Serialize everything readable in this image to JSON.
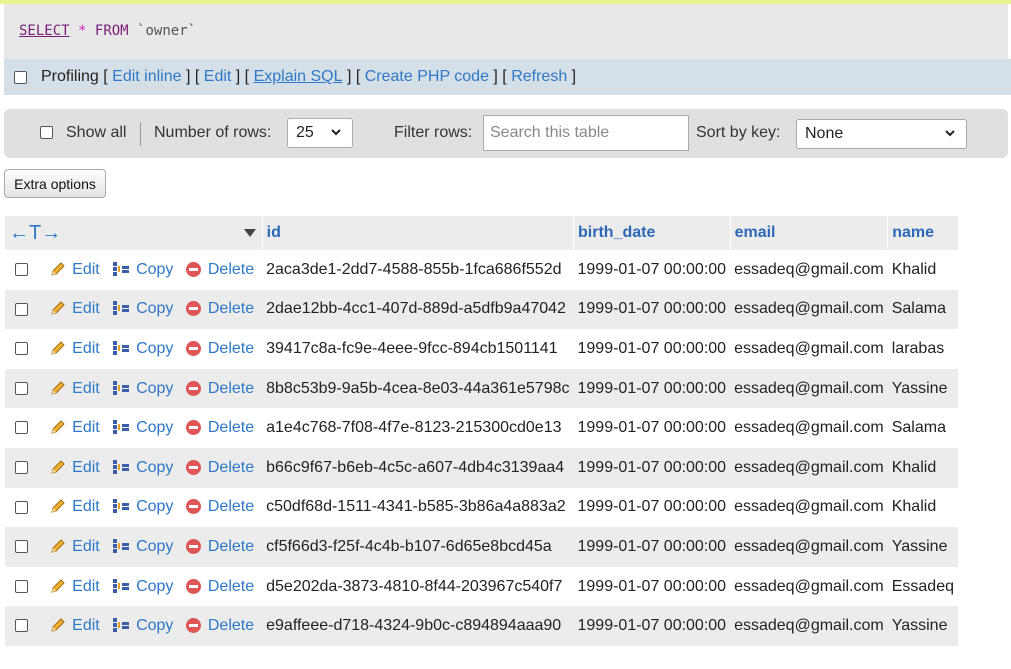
{
  "sql": {
    "select": "SELECT",
    "star": "*",
    "from": "FROM",
    "table": "`owner`"
  },
  "profiling": {
    "label": "Profiling",
    "links": [
      "Edit inline",
      "Edit",
      "Explain SQL",
      "Create PHP code",
      "Refresh"
    ]
  },
  "nav": {
    "show_all": "Show all",
    "rows_label": "Number of rows:",
    "rows_value": "25",
    "filter_label": "Filter rows:",
    "search_placeholder": "Search this table",
    "sort_label": "Sort by key:",
    "sort_value": "None"
  },
  "extra_options": "Extra options",
  "actions": {
    "edit": "Edit",
    "copy": "Copy",
    "delete": "Delete"
  },
  "headers": {
    "arrows": "←T→",
    "id": "id",
    "birth_date": "birth_date",
    "email": "email",
    "name": "name"
  },
  "rows": [
    {
      "id": "2aca3de1-2dd7-4588-855b-1fca686f552d",
      "birth_date": "1999-01-07 00:00:00",
      "email": "essadeq@gmail.com",
      "name": "Khalid"
    },
    {
      "id": "2dae12bb-4cc1-407d-889d-a5dfb9a47042",
      "birth_date": "1999-01-07 00:00:00",
      "email": "essadeq@gmail.com",
      "name": "Salama"
    },
    {
      "id": "39417c8a-fc9e-4eee-9fcc-894cb1501141",
      "birth_date": "1999-01-07 00:00:00",
      "email": "essadeq@gmail.com",
      "name": "larabas"
    },
    {
      "id": "8b8c53b9-9a5b-4cea-8e03-44a361e5798c",
      "birth_date": "1999-01-07 00:00:00",
      "email": "essadeq@gmail.com",
      "name": "Yassine"
    },
    {
      "id": "a1e4c768-7f08-4f7e-8123-215300cd0e13",
      "birth_date": "1999-01-07 00:00:00",
      "email": "essadeq@gmail.com",
      "name": "Salama"
    },
    {
      "id": "b66c9f67-b6eb-4c5c-a607-4db4c3139aa4",
      "birth_date": "1999-01-07 00:00:00",
      "email": "essadeq@gmail.com",
      "name": "Khalid"
    },
    {
      "id": "c50df68d-1511-4341-b585-3b86a4a883a2",
      "birth_date": "1999-01-07 00:00:00",
      "email": "essadeq@gmail.com",
      "name": "Khalid"
    },
    {
      "id": "cf5f66d3-f25f-4c4b-b107-6d65e8bcd45a",
      "birth_date": "1999-01-07 00:00:00",
      "email": "essadeq@gmail.com",
      "name": "Yassine"
    },
    {
      "id": "d5e202da-3873-4810-8f44-203967c540f7",
      "birth_date": "1999-01-07 00:00:00",
      "email": "essadeq@gmail.com",
      "name": "Essadeq"
    },
    {
      "id": "e9affeee-d718-4324-9b0c-c894894aaa90",
      "birth_date": "1999-01-07 00:00:00",
      "email": "essadeq@gmail.com",
      "name": "Yassine"
    }
  ]
}
